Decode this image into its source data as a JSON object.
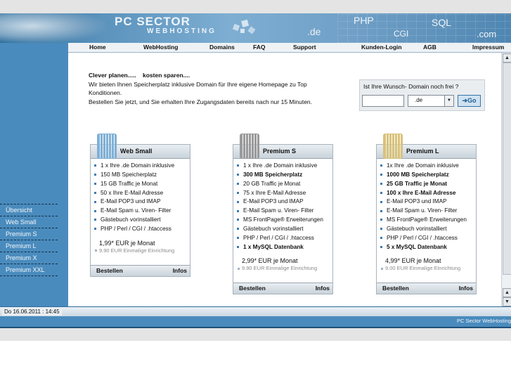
{
  "banner": {
    "title": "PC SECTOR",
    "subtitle": "WEBHOSTING",
    "tld1": ".de",
    "php": "PHP",
    "sql": "SQL",
    "cgi": "CGI",
    "tld2": ".com"
  },
  "nav": [
    "Home",
    "WebHosting",
    "Domains",
    "FAQ",
    "Support",
    "Kunden-Login",
    "AGB",
    "Impressum"
  ],
  "sidebar": [
    "Übersicht",
    "Web Small",
    "Premium S",
    "Premium L",
    "Premium X",
    "Premium XXL"
  ],
  "intro": {
    "heading": "Clever planen.....    kosten sparen....",
    "line1": "Wir bieten Ihnen Speicherplatz inklusive Domain für Ihre eigene Homepage zu Top Konditionen.",
    "line2": "Bestellen Sie jetzt, und Sie erhalten Ihre Zugangsdaten bereits nach nur 15 Minuten."
  },
  "domain_check": {
    "label": "Ist Ihre Wunsch- Domain noch frei ?",
    "input_value": "",
    "tld": ".de",
    "go": "Go"
  },
  "packages": [
    {
      "name": "Web Small",
      "features": [
        {
          "t": "1 x Ihre .de Domain inklusive",
          "b": false
        },
        {
          "t": "150 MB Speicherplatz",
          "b": false
        },
        {
          "t": "15 GB Traffic je Monat",
          "b": false
        },
        {
          "t": "50 x Ihre E-Mail Adresse",
          "b": false
        },
        {
          "t": "E-Mail POP3 und IMAP",
          "b": false
        },
        {
          "t": "E-Mail Spam u. Viren- Filter",
          "b": false
        },
        {
          "t": "Gästebuch vorinstalliert",
          "b": false
        },
        {
          "t": "PHP / Perl / CGI / .htaccess",
          "b": false
        }
      ],
      "price": "1,99* EUR je Monat",
      "setup": "9.90 EUR Einmalige Einrichtung",
      "order": "Bestellen",
      "info": "Infos",
      "icon_color": "#7fb0d6"
    },
    {
      "name": "Premium S",
      "features": [
        {
          "t": "1 x Ihre .de Domain inklusive",
          "b": false
        },
        {
          "t": "300 MB Speicherplatz",
          "b": true
        },
        {
          "t": "20 GB Traffic je Monat",
          "b": false
        },
        {
          "t": "75 x Ihre E-Mail Adresse",
          "b": false
        },
        {
          "t": "E-Mail POP3 und IMAP",
          "b": false
        },
        {
          "t": "E-Mail Spam u. Viren- Filter",
          "b": false
        },
        {
          "t": "MS FrontPage® Erweiterungen",
          "b": false
        },
        {
          "t": "Gästebuch vorinstalliert",
          "b": false
        },
        {
          "t": "PHP / Perl / CGI / .htaccess",
          "b": false
        },
        {
          "t": "1 x MySQL Datenbank",
          "b": true
        }
      ],
      "price": "2,99* EUR je Monat",
      "setup": "9.90 EUR Einmalige Einrichtung",
      "order": "Bestellen",
      "info": "Infos",
      "icon_color": "#9a9a9a"
    },
    {
      "name": "Premium L",
      "features": [
        {
          "t": "1x Ihre .de Domain inklusive",
          "b": false
        },
        {
          "t": "1000 MB Speicherplatz",
          "b": true
        },
        {
          "t": "25 GB Traffic je Monat",
          "b": true
        },
        {
          "t": "100 x Ihre E-Mail Adresse",
          "b": true
        },
        {
          "t": "E-Mail POP3 und IMAP",
          "b": false
        },
        {
          "t": "E-Mail Spam u. Viren- Filter",
          "b": false
        },
        {
          "t": "MS FrontPage® Erweiterungen",
          "b": false
        },
        {
          "t": "Gästebuch vorinstalliert",
          "b": false
        },
        {
          "t": "PHP / Perl / CGI / .htaccess",
          "b": false
        },
        {
          "t": "5 x MySQL Datenbank",
          "b": true
        }
      ],
      "price": "4,99* EUR je Monat",
      "setup": "9.00 EUR Einmalige Einrichtung",
      "order": "Bestellen",
      "info": "Infos",
      "icon_color": "#d9c27a"
    }
  ],
  "status": {
    "datetime": "Do 16.06.2011 : 14:45"
  },
  "footer": {
    "text": "PC Sector WebHosting"
  }
}
